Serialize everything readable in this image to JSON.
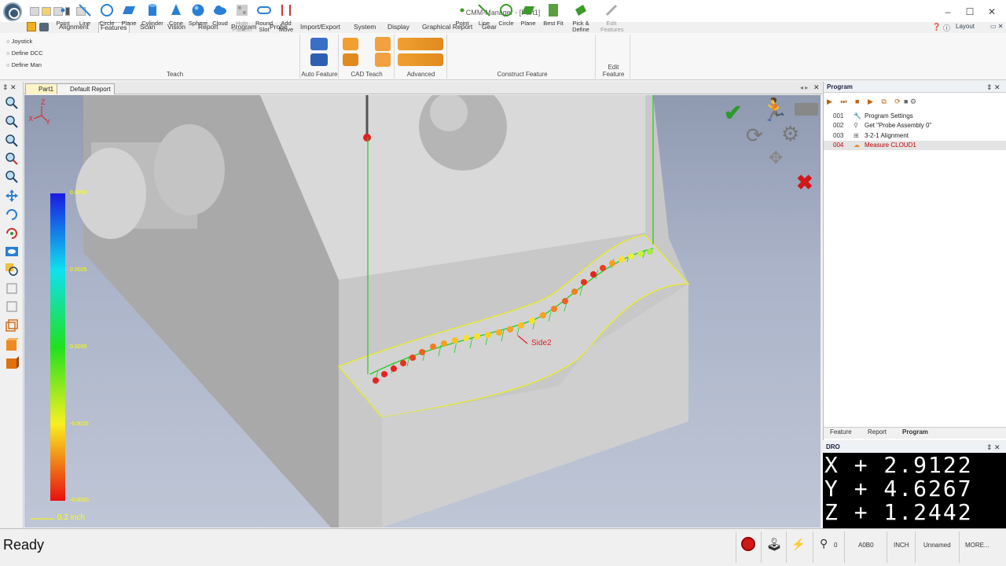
{
  "window": {
    "title": "CMM-Manager - [Part1]",
    "minimize": "–",
    "maximize": "☐",
    "close": "✕"
  },
  "menu": {
    "tabs": [
      "Alignment",
      "Features",
      "Scan",
      "Vision",
      "Report",
      "Program",
      "Probe",
      "Import/Export",
      "System",
      "Display",
      "Graphical Report",
      "Gear"
    ],
    "active": "Features",
    "layout_label": "Layout"
  },
  "ribbon": {
    "motion_modes": [
      "Joystick",
      "Define DCC",
      "Define Man"
    ],
    "teach_buttons": [
      "Point",
      "Line",
      "Circle",
      "Plane",
      "Cylinder",
      "Cone",
      "Sphere",
      "Cloud",
      "Hole Pattern",
      "Round Slot",
      "Add Move"
    ],
    "teach_label": "Teach",
    "auto_feature_label": "Auto Feature",
    "cad_teach_label": "CAD Teach",
    "advanced_label": "Advanced",
    "construct_buttons": [
      "Point",
      "Line",
      "Circle",
      "Plane",
      "Best Fit",
      "Pick & Define"
    ],
    "construct_label": "Construct Feature",
    "edit_features_button": "Edit Features",
    "edit_feature_label": "Edit Feature"
  },
  "doc_tabs": [
    "Part1",
    "Default Report"
  ],
  "viewport": {
    "axis_labels": [
      "Z",
      "X",
      "Y"
    ],
    "legend_ticks": [
      "0.0050",
      "0.0025",
      "0.0000",
      "-0.0025",
      "-0.0050"
    ],
    "scale_label": "0.2 inch",
    "annotation": "Side2",
    "colors": {
      "accept": "#2a9a2a",
      "reject": "#d01818",
      "highlight": "#e4e43a",
      "deviation_fill": "#22cc22"
    }
  },
  "program": {
    "title": "Program",
    "rows": [
      {
        "num": "001",
        "text": "Program Settings",
        "icon": "wrench-icon"
      },
      {
        "num": "002",
        "text": "Get \"Probe Assembly 0\"",
        "icon": "probe-icon"
      },
      {
        "num": "003",
        "text": "3-2-1 Alignment",
        "icon": "alignment-icon"
      },
      {
        "num": "004",
        "text": "Measure CLOUD1",
        "icon": "cloud-icon",
        "selected": true
      }
    ],
    "tabs": [
      "Feature",
      "Report",
      "Program"
    ]
  },
  "dro": {
    "title": "DRO",
    "x": "X  +  2.9122",
    "y": "Y  +  4.6267",
    "z": "Z  +  1.2442"
  },
  "status": {
    "text": "Ready",
    "count": "0",
    "mode": "A0B0",
    "unit": "INCH",
    "name": "Unnamed",
    "more": "MORE..."
  }
}
